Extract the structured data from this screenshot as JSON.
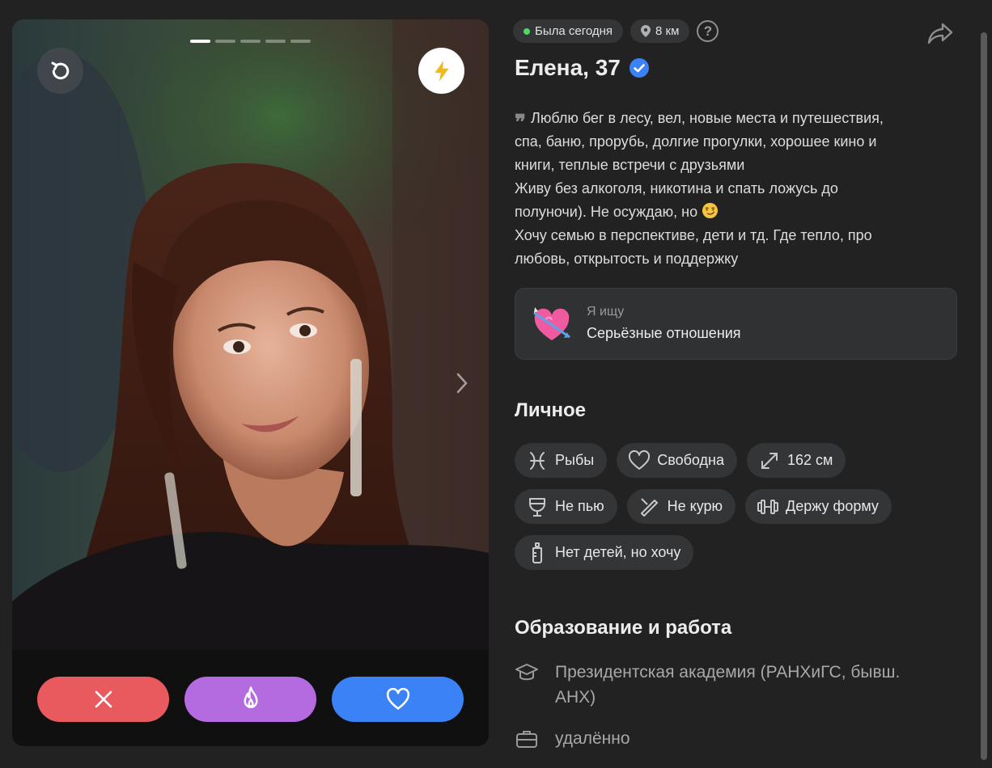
{
  "photo": {
    "progress": [
      true,
      false,
      false,
      false,
      false
    ]
  },
  "actions": {
    "undo_icon": "undo-icon",
    "boost_icon": "lightning-icon",
    "next_icon": "chevron-right-icon",
    "dislike_icon": "close-icon",
    "superlike_icon": "flame-icon",
    "like_icon": "heart-icon"
  },
  "status": {
    "online": "Была сегодня",
    "distance": "8 км",
    "help": "?"
  },
  "profile": {
    "name": "Елена, 37",
    "about_lines": [
      "Люблю бег в лесу, вел, новые места и путешествия,",
      "спа, баню, прорубь, долгие прогулки, хорошее кино и",
      "книги, теплые встречи с друзьями",
      "Живу без алкоголя, никотина и спать ложусь до",
      "полуночи). Не осуждаю, но",
      "Хочу семью в перспективе, дети и тд. Где тепло, про",
      "любовь, открытость и поддержку"
    ],
    "looking_for": {
      "label": "Я ищу",
      "value": "Серьёзные отношения"
    }
  },
  "personal": {
    "title": "Личное",
    "chips": [
      {
        "label": "Рыбы",
        "icon": "pisces-icon"
      },
      {
        "label": "Свободна",
        "icon": "heart-outline-icon"
      },
      {
        "label": "162 см",
        "icon": "expand-icon"
      },
      {
        "label": "Не пью",
        "icon": "glass-icon"
      },
      {
        "label": "Не курю",
        "icon": "no-smoking-icon"
      },
      {
        "label": "Держу форму",
        "icon": "dumbbell-icon"
      },
      {
        "label": "Нет детей, но хочу",
        "icon": "baby-bottle-icon"
      }
    ]
  },
  "education": {
    "title": "Образование и работа",
    "school": [
      "Президентская академия (РАНХиГС, бывш.",
      "АНХ)"
    ],
    "work": "удалённо"
  },
  "colors": {
    "background": "#222222",
    "dislike": "#e85a5e",
    "superlike": "#b36bdf",
    "like": "#3b82f6",
    "verified": "#3b82f6",
    "online": "#4cd964"
  }
}
